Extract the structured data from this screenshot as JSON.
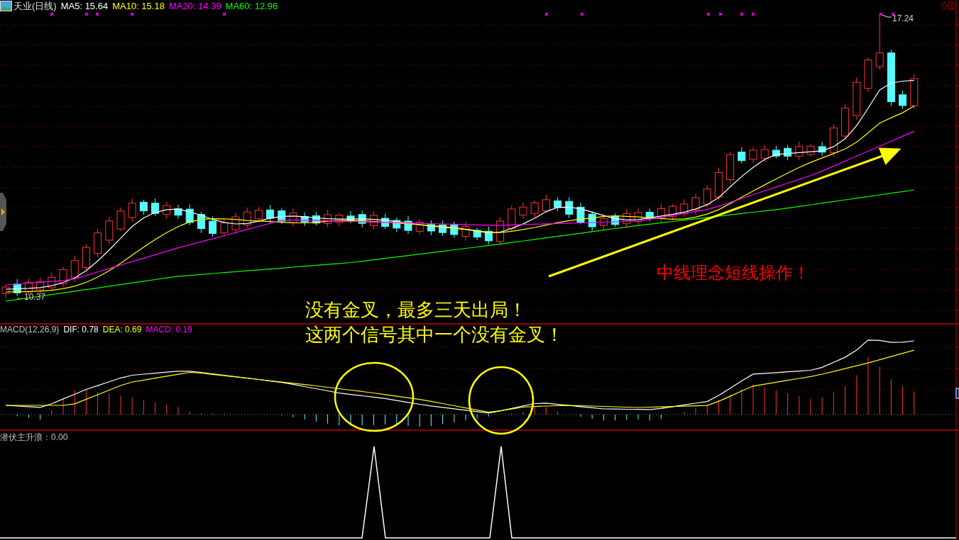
{
  "title_bar": {
    "stock": "天业(日线)",
    "indicators": [
      {
        "label": "MA5: 15.64",
        "color": "#ffffff"
      },
      {
        "label": "MA10: 15.18",
        "color": "#ffff00"
      },
      {
        "label": "MA20: 14.39",
        "color": "#ff00ff"
      },
      {
        "label": "MA60: 12.96",
        "color": "#00ff00"
      }
    ]
  },
  "price_chart": {
    "high_label": "17.24",
    "low_label": "←10.37"
  },
  "annotations": [
    {
      "text": "没有金叉，最多三天出局！",
      "color": "#ffff00"
    },
    {
      "text": "这两个信号其中一个没有金叉！",
      "color": "#ffff00"
    },
    {
      "text": "中线理念短线操作！",
      "color": "#ff0000"
    }
  ],
  "macd_panel": {
    "title": "MACD(12,26,9)",
    "indicators": [
      {
        "label": "DIF: 0.78",
        "color": "#ffffff"
      },
      {
        "label": "DEA: 0.69",
        "color": "#ffff00"
      },
      {
        "label": "MACD: 0.19",
        "color": "#ff00ff"
      }
    ]
  },
  "signal_panel": {
    "title": "潜伏主升浪：0.00"
  }
}
